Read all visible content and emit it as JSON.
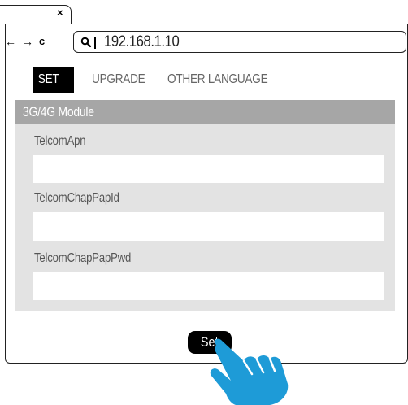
{
  "browser": {
    "tab_close": "×",
    "nav_back": "←",
    "nav_forward": "→",
    "nav_reload": "c",
    "url": "192.168.1.10"
  },
  "menu": {
    "items": [
      {
        "label": "SET",
        "active": true
      },
      {
        "label": "UPGRADE",
        "active": false
      },
      {
        "label": "OTHER LANGUAGE",
        "active": false
      }
    ]
  },
  "panel": {
    "title": "3G/4G Module",
    "fields": [
      {
        "label": "TelcomApn",
        "value": ""
      },
      {
        "label": "TelcomChapPapId",
        "value": ""
      },
      {
        "label": "TelcomChapPapPwd",
        "value": ""
      }
    ]
  },
  "actions": {
    "set_label": "Set"
  },
  "colors": {
    "panel_bg": "#e3e3e3",
    "panel_header_bg": "#a6a6a6",
    "hand_blue": "#1e9bd7",
    "active_menu_bg": "#000000"
  },
  "icons": {
    "tab_close": "close-icon",
    "back": "arrow-left-icon",
    "forward": "arrow-right-icon",
    "reload": "reload-icon",
    "search": "search-icon",
    "pointer": "pointing-hand-icon"
  }
}
